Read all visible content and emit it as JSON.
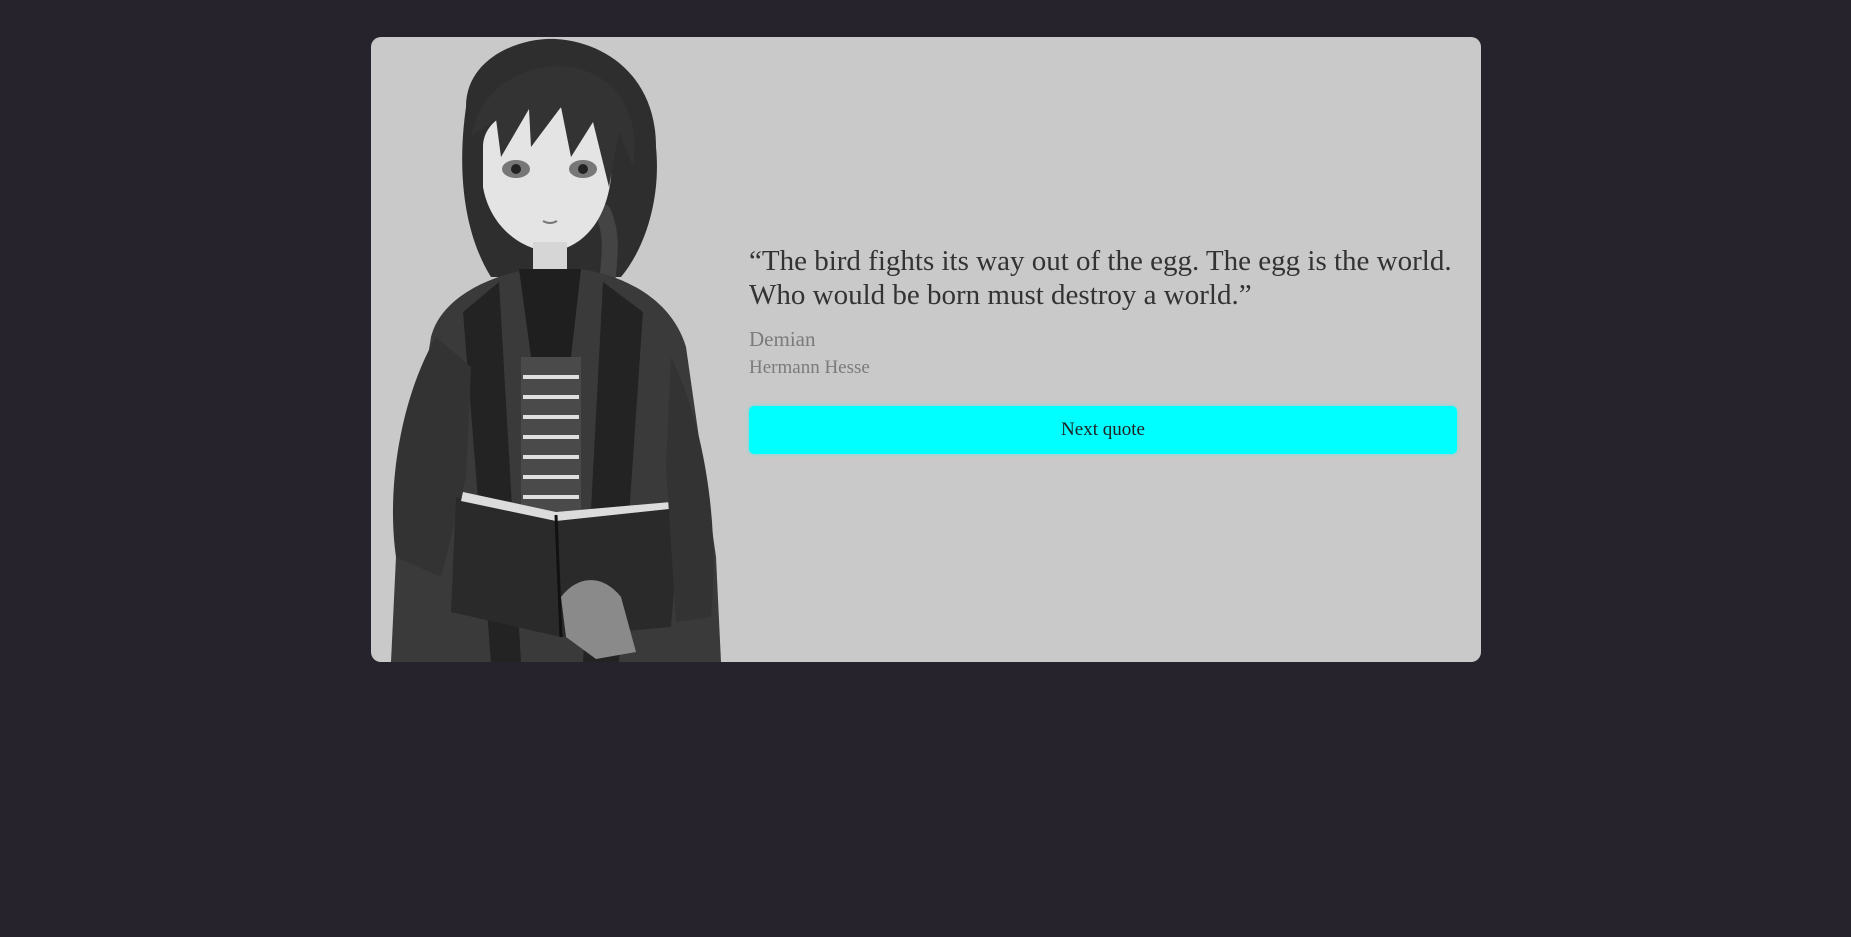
{
  "colors": {
    "page_background": "#26232d",
    "card_background": "#c9c9c9",
    "button_background": "#00ffff",
    "quote_text": "#333333",
    "meta_text": "#7b7b7b"
  },
  "illustration": {
    "icon": "anime-girl-reading-book-illustration"
  },
  "quote": {
    "text": "“The bird fights its way out of the egg. The egg is the world. Who would be born must destroy a world.”",
    "title": "Demian",
    "author": "Hermann Hesse"
  },
  "actions": {
    "next_label": "Next quote"
  }
}
